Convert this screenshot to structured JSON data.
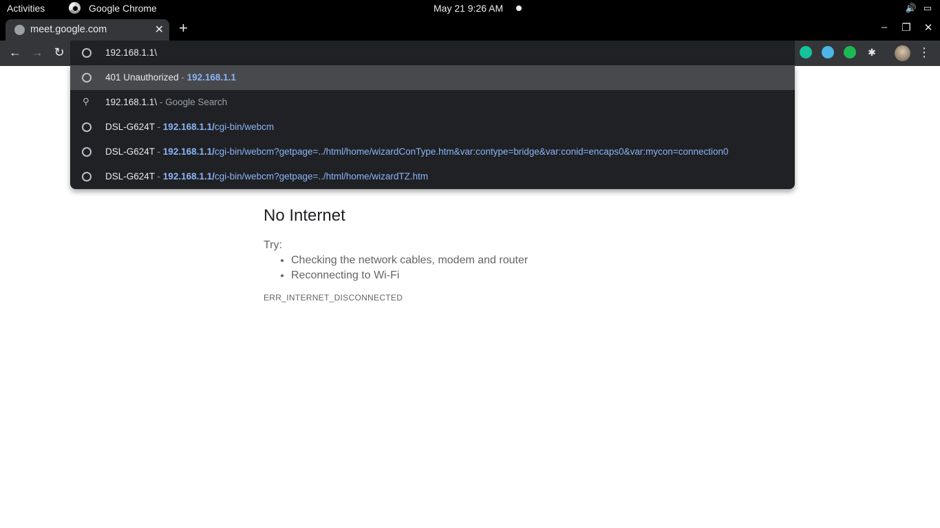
{
  "topbar": {
    "activities": "Activities",
    "app_name": "Google Chrome",
    "clock": "May 21  9:26 AM"
  },
  "tab": {
    "title": "meet.google.com"
  },
  "omnibox": {
    "value": "192.168.1.1\\"
  },
  "suggestions": [
    {
      "title": "401 Unauthorized",
      "sep": " - ",
      "url_bold": "192.168.1.1",
      "url_rest": ""
    },
    {
      "title": "192.168.1.1\\",
      "sep": " - ",
      "suffix": "Google Search"
    },
    {
      "title": "DSL-G624T",
      "sep": " - ",
      "url_bold": "192.168.1.1/",
      "url_rest": "cgi-bin/webcm"
    },
    {
      "title": "DSL-G624T",
      "sep": " - ",
      "url_bold": "192.168.1.1/",
      "url_rest": "cgi-bin/webcm?getpage=../html/home/wizardConType.htm&var:contype=bridge&var:conid=encaps0&var:mycon=connection0"
    },
    {
      "title": "DSL-G624T",
      "sep": " - ",
      "url_bold": "192.168.1.1/",
      "url_rest": "cgi-bin/webcm?getpage=../html/home/wizardTZ.htm"
    }
  ],
  "page": {
    "heading": "No Internet",
    "try_label": "Try:",
    "tips": [
      "Checking the network cables, modem and router",
      "Reconnecting to Wi-Fi"
    ],
    "error_code": "ERR_INTERNET_DISCONNECTED"
  },
  "colors": {
    "accent_link": "#8ab4f8",
    "toolbar": "#35363a",
    "omnibox": "#202124"
  },
  "icons": [
    "chrome-icon",
    "globe-icon",
    "search-icon",
    "back-icon",
    "forward-icon",
    "reload-icon",
    "grammarly-icon",
    "extension-icon",
    "menu-icon"
  ]
}
